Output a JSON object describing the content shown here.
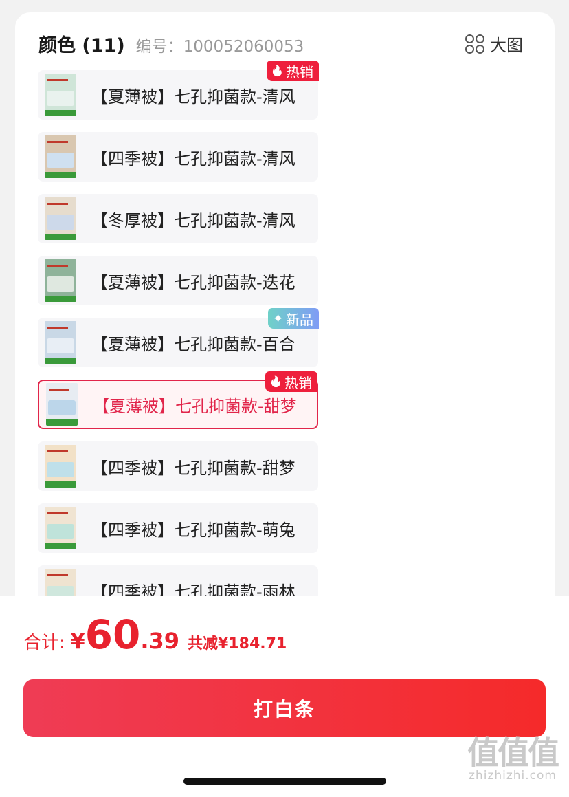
{
  "header": {
    "title": "颜色 (11)",
    "sku_label": "编号：100052060053",
    "big_view_label": "大图",
    "big_view_icon": "grid-circles-icon"
  },
  "options": [
    {
      "label": "【夏薄被】七孔抑菌款-清风",
      "tag": "热销",
      "tag_type": "hot",
      "selected": false
    },
    {
      "label": "【四季被】七孔抑菌款-清风",
      "tag": "",
      "tag_type": "",
      "selected": false
    },
    {
      "label": "【冬厚被】七孔抑菌款-清风",
      "tag": "",
      "tag_type": "",
      "selected": false
    },
    {
      "label": "【夏薄被】七孔抑菌款-迭花",
      "tag": "",
      "tag_type": "",
      "selected": false
    },
    {
      "label": "【夏薄被】七孔抑菌款-百合",
      "tag": "新品",
      "tag_type": "new",
      "selected": false
    },
    {
      "label": "【夏薄被】七孔抑菌款-甜梦",
      "tag": "热销",
      "tag_type": "hot",
      "selected": true
    },
    {
      "label": "【四季被】七孔抑菌款-甜梦",
      "tag": "",
      "tag_type": "",
      "selected": false
    },
    {
      "label": "【四季被】七孔抑菌款-萌兔",
      "tag": "",
      "tag_type": "",
      "selected": false
    },
    {
      "label": "【四季被】七孔抑菌款-雨林",
      "tag": "",
      "tag_type": "",
      "selected": false
    }
  ],
  "footer": {
    "total_label": "合计:",
    "currency": "¥",
    "price_int": "60",
    "price_dec": ".39",
    "discount": "共减¥184.71",
    "cta_label": "打白条"
  },
  "watermark": {
    "big": "值值值",
    "small": "zhizhizhi.com"
  },
  "colors": {
    "accent": "#e8222e",
    "hot_tag": "#ee1f3c",
    "selected_border": "#e1254a"
  }
}
